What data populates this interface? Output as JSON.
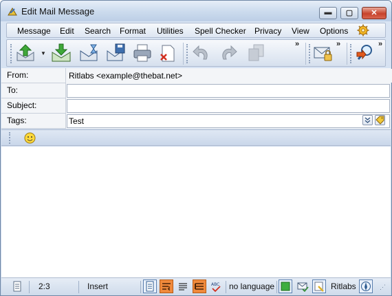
{
  "window": {
    "title": "Edit Mail Message",
    "controls": {
      "minimize": "▬",
      "maximize": "▢",
      "close": "✕"
    }
  },
  "menubar": {
    "items": [
      {
        "label": "Message"
      },
      {
        "label": "Edit"
      },
      {
        "label": "Search"
      },
      {
        "label": "Format"
      },
      {
        "label": "Utilities"
      },
      {
        "label": "Spell Checker"
      },
      {
        "label": "Privacy"
      },
      {
        "label": "View"
      },
      {
        "label": "Options"
      }
    ],
    "extra_icon": "gear-icon"
  },
  "toolbar": {
    "buttons": [
      {
        "icon": "send-queue-icon"
      },
      {
        "icon": "send-now-icon"
      },
      {
        "icon": "postpone-icon"
      },
      {
        "icon": "save-draft-icon"
      },
      {
        "icon": "print-icon"
      },
      {
        "icon": "discard-icon"
      },
      {
        "icon": "undo-icon"
      },
      {
        "icon": "redo-icon"
      },
      {
        "icon": "copy-icon"
      },
      {
        "icon": "encrypt-icon"
      },
      {
        "icon": "find-icon"
      }
    ],
    "more": "»"
  },
  "fields": {
    "from": {
      "label": "From:",
      "value": "Ritlabs <example@thebat.net>"
    },
    "to": {
      "label": "To:",
      "value": ""
    },
    "subject": {
      "label": "Subject:",
      "value": ""
    },
    "tags": {
      "label": "Tags:",
      "value": "Test"
    }
  },
  "formatting": {
    "emoticon_icon": "smiley-icon"
  },
  "editor": {
    "body": ""
  },
  "statusbar": {
    "position": "2:3",
    "mode": "Insert",
    "language": "no language",
    "account": "Ritlabs"
  },
  "colors": {
    "accent": "#2f6fbf",
    "status_active": "#f08a3c",
    "close_button": "#c7432c"
  }
}
